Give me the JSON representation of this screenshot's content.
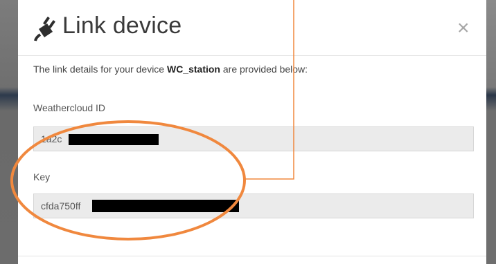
{
  "dialog": {
    "title": "Link device",
    "close_label": "×",
    "description_prefix": "The link details for your device ",
    "device_name": "WC_station",
    "description_suffix": " are provided below:"
  },
  "fields": {
    "weathercloud_id": {
      "label": "Weathercloud ID",
      "value_visible": "1a2c"
    },
    "key": {
      "label": "Key",
      "value_visible": "cfda750ff"
    }
  },
  "annotation": {
    "color": "#f0883e"
  },
  "icons": {
    "title_icon": "plug-icon",
    "close_icon": "close-icon"
  }
}
